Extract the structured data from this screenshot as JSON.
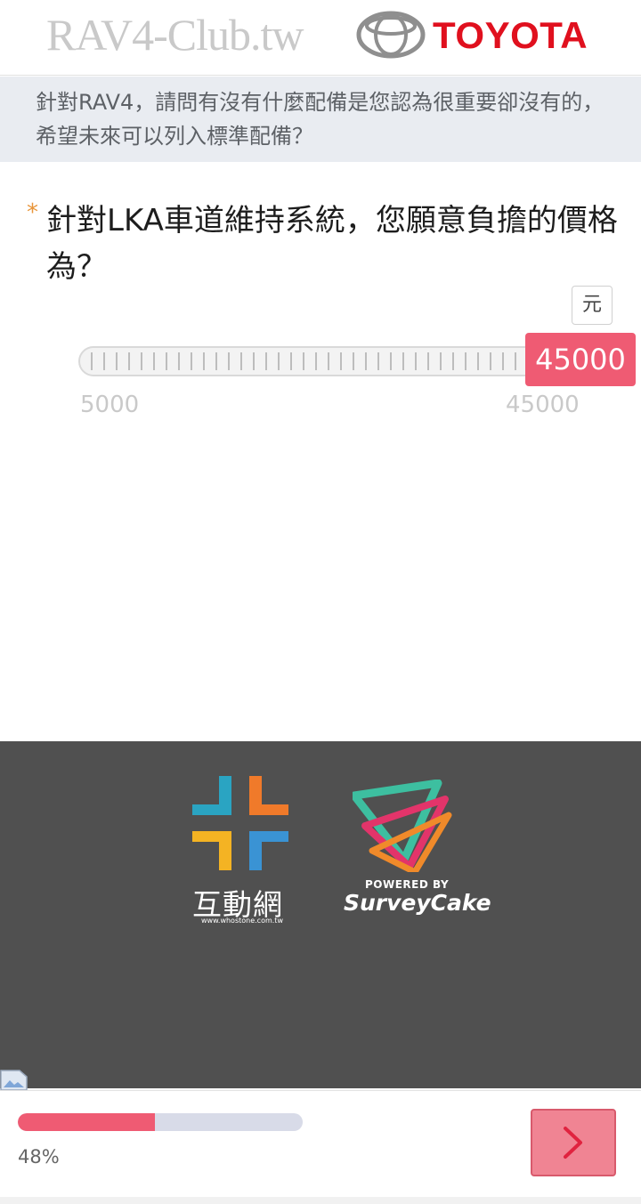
{
  "header": {
    "site_title": "RAV4-Club.tw",
    "brand_name": "TOYOTA",
    "brand_color": "#e0101e"
  },
  "context": {
    "text": "針對RAV4，請問有沒有什麼配備是您認為很重要卻沒有的，希望未來可以列入標準配備？"
  },
  "question": {
    "required_mark": "*",
    "text": "針對LKA車道維持系統，您願意負擔的價格為？",
    "unit": "元"
  },
  "slider": {
    "value": "45000",
    "min_label": "5000",
    "max_label": "45000",
    "min": 5000,
    "max": 45000,
    "current": 45000
  },
  "footer": {
    "partner_name": "互動網",
    "partner_url": "www.whostone.com.tw",
    "powered_by": "POWERED BY",
    "platform_name": "SurveyCake",
    "background": "#505050"
  },
  "progress": {
    "label": "48%",
    "fraction": 0.48,
    "accent": "#ef5b73"
  },
  "navigation": {
    "next_icon": "chevron-right-icon"
  }
}
